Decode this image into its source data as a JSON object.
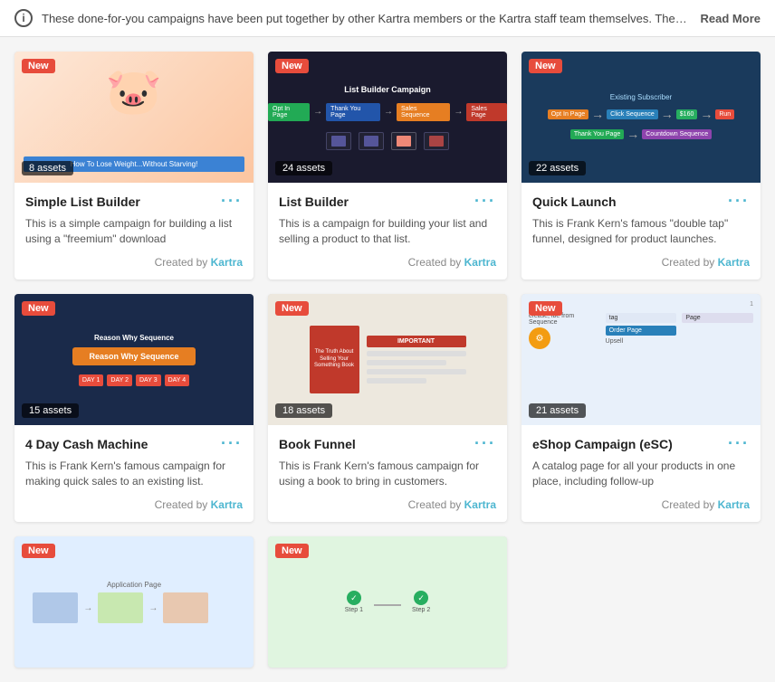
{
  "infoBar": {
    "text": "These done-for-you campaigns have been put together by other Kartra members or the Kartra staff team themselves. They w...",
    "readMoreLabel": "Read More"
  },
  "cards": [
    {
      "id": "simple-list-builder",
      "badge": "New",
      "assets": "8 assets",
      "title": "Simple List Builder",
      "description": "This is a simple campaign for building a list using a \"freemium\" download",
      "createdBy": "Created by ",
      "creator": "Kartra",
      "thumbStyle": "thumb-1"
    },
    {
      "id": "list-builder",
      "badge": "New",
      "assets": "24 assets",
      "title": "List Builder",
      "description": "This is a campaign for building your list and selling a product to that list.",
      "createdBy": "Created by ",
      "creator": "Kartra",
      "thumbStyle": "thumb-2"
    },
    {
      "id": "quick-launch",
      "badge": "New",
      "assets": "22 assets",
      "title": "Quick Launch",
      "description": "This is Frank Kern's famous \"double tap\" funnel, designed for product launches.",
      "createdBy": "Created by ",
      "creator": "Kartra",
      "thumbStyle": "thumb-3"
    },
    {
      "id": "4-day-cash-machine",
      "badge": "New",
      "assets": "15 assets",
      "title": "4 Day Cash Machine",
      "description": "This is Frank Kern's famous campaign for making quick sales to an existing list.",
      "createdBy": "Created by ",
      "creator": "Kartra",
      "thumbStyle": "thumb-4"
    },
    {
      "id": "book-funnel",
      "badge": "New",
      "assets": "18 assets",
      "title": "Book Funnel",
      "description": "This is Frank Kern's famous campaign for using a book to bring in customers.",
      "createdBy": "Created by ",
      "creator": "Kartra",
      "thumbStyle": "thumb-5"
    },
    {
      "id": "eshop-campaign",
      "badge": "New",
      "assets": "21 assets",
      "title": "eShop Campaign (eSC)",
      "description": "A catalog page for all your products in one place, including follow-up",
      "createdBy": "Created by ",
      "creator": "Kartra",
      "thumbStyle": "thumb-6"
    },
    {
      "id": "card-7",
      "badge": "New",
      "assets": "",
      "title": "",
      "description": "",
      "createdBy": "",
      "creator": "",
      "thumbStyle": "thumb-7"
    },
    {
      "id": "card-8",
      "badge": "New",
      "assets": "",
      "title": "",
      "description": "",
      "createdBy": "",
      "creator": "",
      "thumbStyle": "thumb-8"
    }
  ],
  "thumbColors": {
    "thumb-1": "#f9e4d4",
    "thumb-2": "#1a1a2e",
    "thumb-3": "#1a3a5c",
    "thumb-4": "#1a2a4a",
    "thumb-5": "#f0ebe0",
    "thumb-6": "#e8f0fa",
    "thumb-7": "#e0f0ff",
    "thumb-8": "#e0f5e0"
  }
}
